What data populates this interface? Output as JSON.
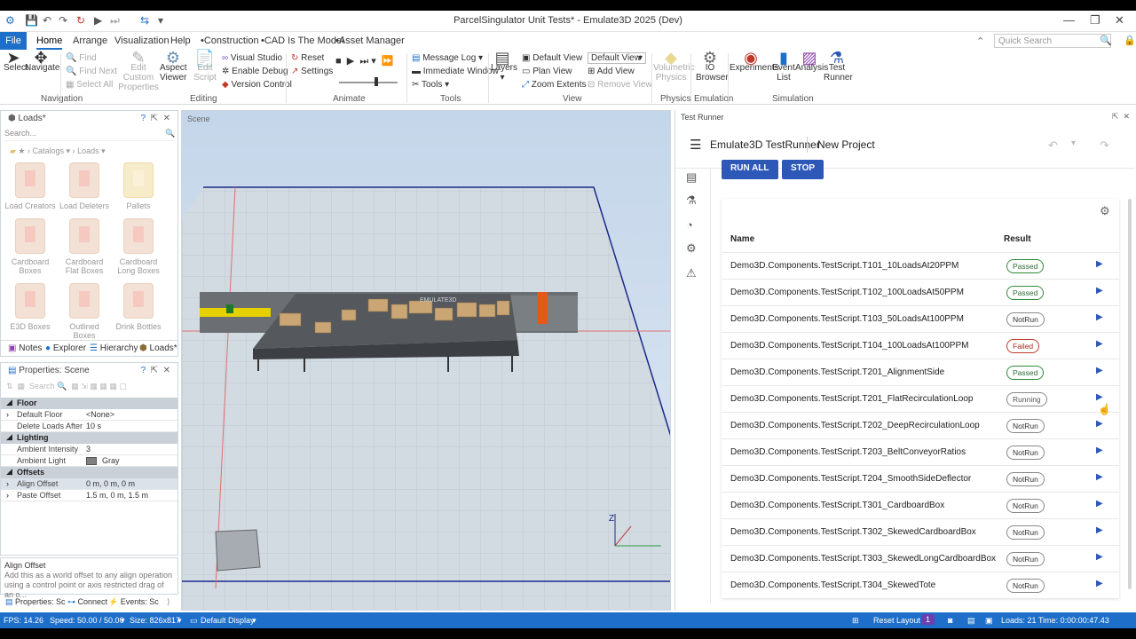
{
  "window": {
    "title": "ParcelSingulator Unit Tests* - Emulate3D 2025 (Dev)"
  },
  "menu": {
    "file": "File",
    "tabs": [
      "Home",
      "Arrange",
      "Visualization",
      "Help",
      "•Construction",
      "•CAD Is The Model",
      "•Asset Manager"
    ],
    "search_placeholder": "Quick Search"
  },
  "ribbon": {
    "navigation": {
      "select": "Select",
      "navigate": "Navigate",
      "group": "Navigation"
    },
    "editing": {
      "find": "Find",
      "find_next": "Find Next",
      "select_all": "Select All",
      "edit_custom": "Edit Custom Properties",
      "aspect_viewer": "Aspect Viewer",
      "edit_script": "Edit Script",
      "visual_studio": "Visual Studio",
      "enable_debug": "Enable Debug",
      "version_control": "Version Control",
      "group": "Editing"
    },
    "animate": {
      "reset": "Reset",
      "settings": "Settings",
      "group": "Animate"
    },
    "tools": {
      "message_log": "Message Log",
      "immediate_window": "Immediate Window",
      "tools": "Tools",
      "group": "Tools"
    },
    "view": {
      "layers": "Layers",
      "default_view": "Default View",
      "plan_view": "Plan View",
      "zoom_extents": "Zoom Extents",
      "view_select": "Default View",
      "add_view": "Add View",
      "remove_view": "Remove View",
      "group": "View"
    },
    "physics": {
      "volumetric": "Volumetric Physics",
      "group": "Physics"
    },
    "emulation": {
      "io_browser": "IO Browser",
      "group": "Emulation"
    },
    "simulation": {
      "experiments": "Experiments",
      "event_list": "Event List",
      "analysis": "Analysis",
      "test_runner": "Test Runner",
      "group": "Simulation"
    }
  },
  "loads_panel": {
    "title": "Loads*",
    "search": "Search...",
    "breadcrumb": [
      "Catalogs",
      "Loads"
    ],
    "items": [
      "Load Creators",
      "Load Deleters",
      "Pallets",
      "Cardboard Boxes",
      "Cardboard Flat Boxes",
      "Cardboard Long Boxes",
      "E3D Boxes",
      "Outlined Boxes",
      "Drink Bottles"
    ],
    "tabs": [
      "Notes",
      "Explorer",
      "Hierarchy",
      "Loads*"
    ]
  },
  "properties": {
    "title": "Properties: Scene",
    "search": "Search",
    "rows": [
      {
        "cat": "Floor"
      },
      {
        "k": "Default Floor",
        "v": "<None>"
      },
      {
        "k": "Delete Loads After",
        "v": "10 s"
      },
      {
        "cat": "Lighting"
      },
      {
        "k": "Ambient Intensity",
        "v": "3"
      },
      {
        "k": "Ambient Light",
        "v": "Gray"
      },
      {
        "cat": "Offsets"
      },
      {
        "k": "Align Offset",
        "v": "0 m, 0 m, 0 m"
      },
      {
        "k": "Paste Offset",
        "v": "1.5 m, 0 m, 1.5 m"
      }
    ],
    "info_title": "Align Offset",
    "info_text": "Add this as a world offset to any align operation using a control point or axis restricted drag of an o..."
  },
  "bottom_tabs": [
    "Properties: Sc",
    "Connect",
    "Events: Sc"
  ],
  "scene": {
    "title": "Scene",
    "logo": "EMULATE3D"
  },
  "test_runner": {
    "panel_title": "Test Runner",
    "app_title": "Emulate3D TestRunner",
    "project": "New Project",
    "run_all": "RUN ALL",
    "stop": "STOP",
    "col_name": "Name",
    "col_result": "Result",
    "tests": [
      {
        "name": "Demo3D.Components.TestScript.T101_10LoadsAt20PPM",
        "result": "Passed"
      },
      {
        "name": "Demo3D.Components.TestScript.T102_100LoadsAt50PPM",
        "result": "Passed"
      },
      {
        "name": "Demo3D.Components.TestScript.T103_50LoadsAt100PPM",
        "result": "NotRun"
      },
      {
        "name": "Demo3D.Components.TestScript.T104_100LoadsAt100PPM",
        "result": "Failed"
      },
      {
        "name": "Demo3D.Components.TestScript.T201_AlignmentSide",
        "result": "Passed"
      },
      {
        "name": "Demo3D.Components.TestScript.T201_FlatRecirculationLoop",
        "result": "Running"
      },
      {
        "name": "Demo3D.Components.TestScript.T202_DeepRecirculationLoop",
        "result": "NotRun"
      },
      {
        "name": "Demo3D.Components.TestScript.T203_BeltConveyorRatios",
        "result": "NotRun"
      },
      {
        "name": "Demo3D.Components.TestScript.T204_SmoothSideDeflector",
        "result": "NotRun"
      },
      {
        "name": "Demo3D.Components.TestScript.T301_CardboardBox",
        "result": "NotRun"
      },
      {
        "name": "Demo3D.Components.TestScript.T302_SkewedCardboardBox",
        "result": "NotRun"
      },
      {
        "name": "Demo3D.Components.TestScript.T303_SkewedLongCardboardBox",
        "result": "NotRun"
      },
      {
        "name": "Demo3D.Components.TestScript.T304_SkewedTote",
        "result": "NotRun"
      }
    ]
  },
  "status": {
    "fps": "FPS: 14.26",
    "speed": "Speed: 50.00 / 50.00",
    "size": "Size: 826x817",
    "display": "Default Display",
    "reset_layout": "Reset Layout",
    "badge": "1",
    "loads": "Loads: 21",
    "time": "Time: 0:00:00:47.43"
  },
  "colors": {
    "accent": "#1e6fc9",
    "button": "#2d58b8",
    "passed": "#2e8b3a",
    "failed": "#c0392b"
  }
}
